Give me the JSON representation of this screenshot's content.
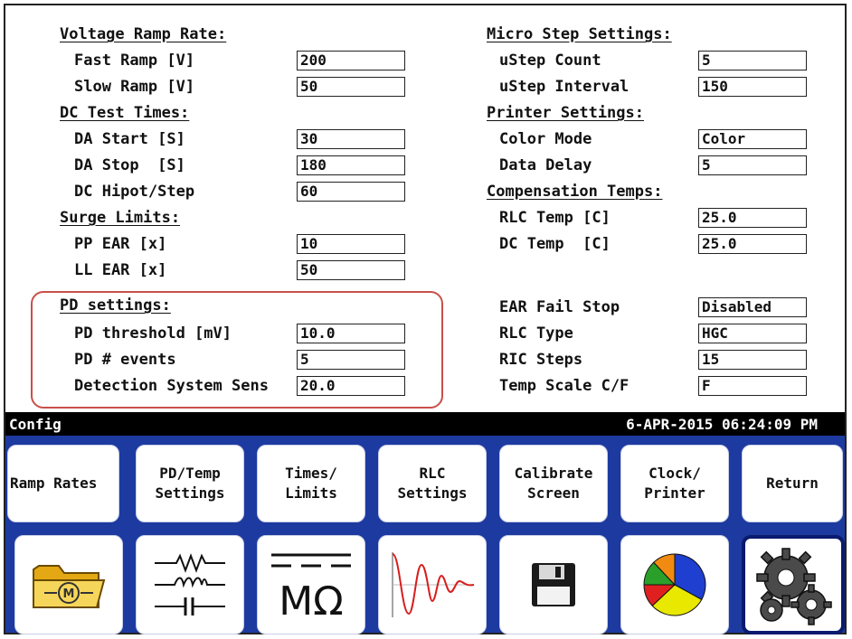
{
  "left_column": {
    "voltage_header": "Voltage Ramp Rate:",
    "fast_ramp": {
      "label": "Fast Ramp [V]",
      "value": "200"
    },
    "slow_ramp": {
      "label": "Slow Ramp [V]",
      "value": "50"
    },
    "dc_header": "DC Test Times:",
    "da_start": {
      "label": "DA Start [S]",
      "value": "30"
    },
    "da_stop": {
      "label": "DA Stop  [S]",
      "value": "180"
    },
    "dc_hipot": {
      "label": "DC Hipot/Step",
      "value": "60"
    },
    "surge_header": "Surge Limits:",
    "pp_ear": {
      "label": "PP EAR [x]",
      "value": "10"
    },
    "ll_ear": {
      "label": "LL EAR [x]",
      "value": "50"
    },
    "pd_header": "PD settings:",
    "pd_threshold": {
      "label": "PD threshold [mV]",
      "value": "10.0"
    },
    "pd_events": {
      "label": "PD # events",
      "value": "5"
    },
    "detection_sens": {
      "label": "Detection System Sens",
      "value": "20.0"
    }
  },
  "right_column": {
    "micro_header": "Micro Step Settings:",
    "ustep_count": {
      "label": "uStep Count",
      "value": "5"
    },
    "ustep_interval": {
      "label": "uStep Interval",
      "value": "150"
    },
    "printer_header": "Printer Settings:",
    "color_mode": {
      "label": "Color Mode",
      "value": "Color"
    },
    "data_delay": {
      "label": "Data Delay",
      "value": "5"
    },
    "comp_header": "Compensation Temps:",
    "rlc_temp": {
      "label": "RLC Temp [C]",
      "value": "25.0"
    },
    "dc_temp": {
      "label": "DC Temp  [C]",
      "value": "25.0"
    },
    "ear_fail": {
      "label": "EAR Fail Stop",
      "value": "Disabled"
    },
    "rlc_type": {
      "label": "RLC Type",
      "value": "HGC"
    },
    "ric_steps": {
      "label": "RIC Steps",
      "value": "15"
    },
    "temp_scale": {
      "label": "Temp Scale C/F",
      "value": "F"
    }
  },
  "status": {
    "title": "Config",
    "datetime": "6-APR-2015 06:24:09 PM"
  },
  "softkeys": [
    {
      "label": "Ramp Rates"
    },
    {
      "label": "PD/Temp\nSettings"
    },
    {
      "label": "Times/\nLimits"
    },
    {
      "label": "RLC\nSettings"
    },
    {
      "label": "Calibrate\nScreen"
    },
    {
      "label": "Clock/\nPrinter"
    },
    {
      "label": "Return"
    }
  ],
  "icons": {
    "motor_folder_text": "M",
    "megohm_text": "MΩ",
    "pie_colors": [
      "#1f3fd1",
      "#e8e800",
      "#e02020",
      "#2aa02a",
      "#f08a10"
    ]
  },
  "colors": {
    "panel": "#1d3aa0",
    "status_bar": "#000000",
    "highlight": "#c8504a"
  }
}
